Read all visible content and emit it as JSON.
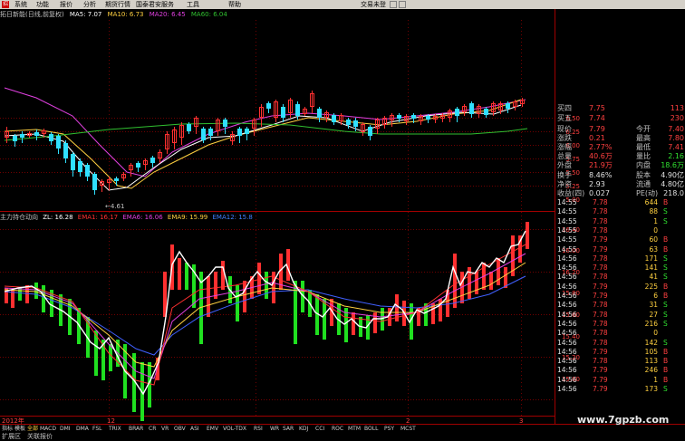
{
  "menu": {
    "items": [
      "系统",
      "功能",
      "报价",
      "分析",
      "期货行情",
      "国泰君安服务",
      "工具",
      "帮助"
    ],
    "right": "交易未登"
  },
  "indicator_line": {
    "title": "拓日新能(日线,前复权)",
    "ma5": "MA5: 7.07",
    "ma10": "MA10: 6.73",
    "ma20": "MA20: 6.45",
    "ma60": "MA60: 6.04",
    "low_mark": "4.61"
  },
  "sub_legend": {
    "title": "主力持仓动向",
    "zl": "ZL: 16.28",
    "ema1": "EMA1: 16.17",
    "ema6": "EMA6: 16.06",
    "ema9": "EMA9: 15.99",
    "ema12": "EMA12: 15.8"
  },
  "quote": {
    "rows": [
      {
        "label": "买四",
        "value": "7.75",
        "extra": "",
        "extra_value": "113"
      },
      {
        "label": "买五",
        "value": "7.74",
        "extra": "",
        "extra_value": "230"
      },
      {
        "label": "现价",
        "value": "7.79",
        "extra": "今开",
        "extra_value": "7.40"
      },
      {
        "label": "涨跌",
        "value": "0.21",
        "extra": "最高",
        "extra_value": "7.80"
      },
      {
        "label": "涨幅",
        "value": "2.77%",
        "extra": "最低",
        "extra_value": "7.41"
      },
      {
        "label": "总量",
        "value": "40.6万",
        "extra": "量比",
        "extra_value": "2.16"
      },
      {
        "label": "外盘",
        "value": "21.9万",
        "extra": "内盘",
        "extra_value": "18.6万"
      },
      {
        "label": "换手",
        "value": "8.46%",
        "extra": "股本",
        "extra_value": "4.90亿"
      },
      {
        "label": "净资",
        "value": "2.93",
        "extra": "流通",
        "extra_value": "4.80亿"
      },
      {
        "label": "收益(四)",
        "value": "0.027",
        "extra": "PE(动)",
        "extra_value": "218.0"
      }
    ]
  },
  "trades": [
    {
      "time": "14:55",
      "price": "7.78",
      "vol": "644",
      "side": "B"
    },
    {
      "time": "14:55",
      "price": "7.78",
      "vol": "88",
      "side": "S"
    },
    {
      "time": "14:55",
      "price": "7.78",
      "vol": "1",
      "side": "S"
    },
    {
      "time": "14:55",
      "price": "7.78",
      "vol": "0",
      "side": ""
    },
    {
      "time": "14:55",
      "price": "7.79",
      "vol": "60",
      "side": "B"
    },
    {
      "time": "14:55",
      "price": "7.79",
      "vol": "63",
      "side": "B"
    },
    {
      "time": "14:56",
      "price": "7.78",
      "vol": "171",
      "side": "S"
    },
    {
      "time": "14:56",
      "price": "7.78",
      "vol": "141",
      "side": "S"
    },
    {
      "time": "14:56",
      "price": "7.78",
      "vol": "41",
      "side": "S"
    },
    {
      "time": "14:56",
      "price": "7.79",
      "vol": "225",
      "side": "B"
    },
    {
      "time": "14:56",
      "price": "7.79",
      "vol": "6",
      "side": "B"
    },
    {
      "time": "14:56",
      "price": "7.78",
      "vol": "31",
      "side": "S"
    },
    {
      "time": "14:56",
      "price": "7.78",
      "vol": "27",
      "side": "S"
    },
    {
      "time": "14:56",
      "price": "7.78",
      "vol": "216",
      "side": "S"
    },
    {
      "time": "14:56",
      "price": "7.78",
      "vol": "0",
      "side": ""
    },
    {
      "time": "14:56",
      "price": "7.78",
      "vol": "142",
      "side": "S"
    },
    {
      "time": "14:56",
      "price": "7.79",
      "vol": "105",
      "side": "B"
    },
    {
      "time": "14:56",
      "price": "7.78",
      "vol": "113",
      "side": "B"
    },
    {
      "time": "14:56",
      "price": "7.79",
      "vol": "246",
      "side": "B"
    },
    {
      "time": "14:56",
      "price": "7.79",
      "vol": "1",
      "side": "B"
    },
    {
      "time": "14:56",
      "price": "7.79",
      "vol": "173",
      "side": "S"
    }
  ],
  "tabs": [
    "指标",
    "模板",
    "全部",
    "MACD",
    "DMI",
    "DMA",
    "FSL",
    "TRIX",
    "BRAR",
    "CR",
    "VR",
    "OBV",
    "ASI",
    "EMV",
    "VOL-TDX",
    "RSI",
    "WR",
    "SAR",
    "KDJ",
    "CCI",
    "ROC",
    "MTM",
    "BOLL",
    "PSY",
    "MCST"
  ],
  "status": {
    "left": "扩展区",
    "mid": "关联报价"
  },
  "axis": {
    "price_ticks": [
      "6.50",
      "6.25",
      "6.00",
      "5.75",
      "5.50",
      "5.25",
      "5.00"
    ],
    "sub_ticks": [
      "16.40",
      "16.20",
      "16.00",
      "15.80",
      "15.60",
      "15.40",
      "15.20",
      "15.00"
    ],
    "date_labels": [
      "2012年",
      "12",
      "2",
      "3"
    ]
  },
  "watermark": "www.7gpzb.com",
  "colors": {
    "up": "#ff3030",
    "down": "#20e020",
    "ma5": "#ffffff",
    "ma10": "#ffd040",
    "ma20": "#e040e0",
    "ma60": "#30c030",
    "grid": "#700000"
  }
}
